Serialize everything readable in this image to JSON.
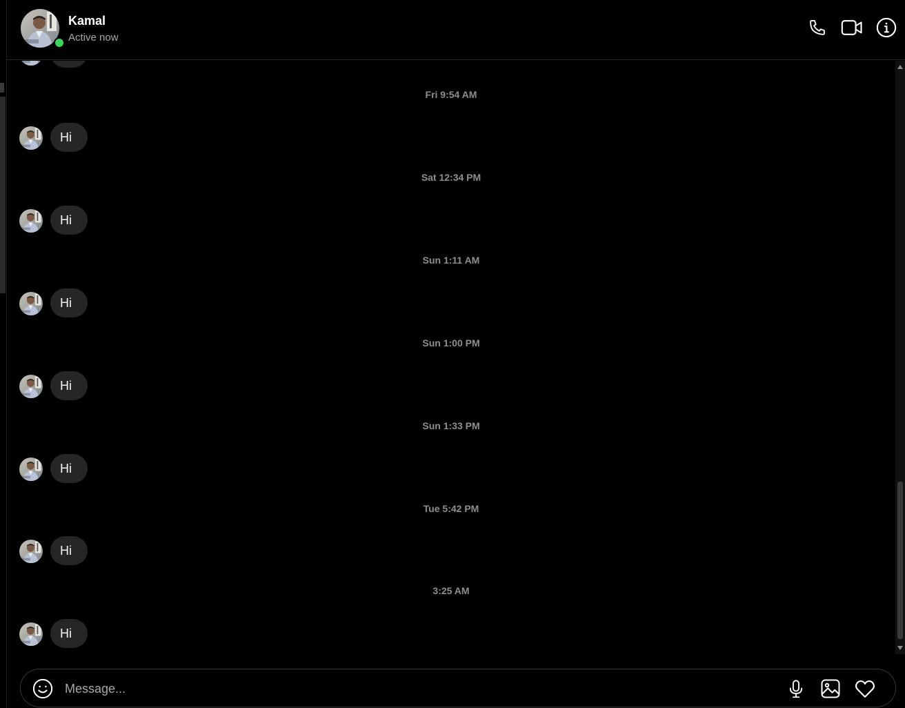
{
  "header": {
    "name": "Kamal",
    "status": "Active now",
    "icons": [
      "phone-icon",
      "video-camera-icon",
      "info-icon"
    ]
  },
  "thread": {
    "items": [
      {
        "type": "timestamp",
        "text": "Fri 9:54 AM"
      },
      {
        "type": "message",
        "text": "Hi"
      },
      {
        "type": "timestamp",
        "text": "Sat 12:34 PM"
      },
      {
        "type": "message",
        "text": "Hi"
      },
      {
        "type": "timestamp",
        "text": "Sun 1:11 AM"
      },
      {
        "type": "message",
        "text": "Hi"
      },
      {
        "type": "timestamp",
        "text": "Sun 1:00 PM"
      },
      {
        "type": "message",
        "text": "Hi"
      },
      {
        "type": "timestamp",
        "text": "Sun 1:33 PM"
      },
      {
        "type": "message",
        "text": "Hi"
      },
      {
        "type": "timestamp",
        "text": "Tue 5:42 PM"
      },
      {
        "type": "message",
        "text": "Hi"
      },
      {
        "type": "timestamp",
        "text": "3:25 AM"
      },
      {
        "type": "message",
        "text": "Hi"
      }
    ]
  },
  "composer": {
    "placeholder": "Message...",
    "value": "",
    "icons": [
      "emoji-icon",
      "microphone-icon",
      "image-icon",
      "heart-icon"
    ]
  },
  "colors": {
    "background": "#000000",
    "bubble": "#262626",
    "online": "#3fd25c",
    "muted_text": "#8e8e8e"
  }
}
